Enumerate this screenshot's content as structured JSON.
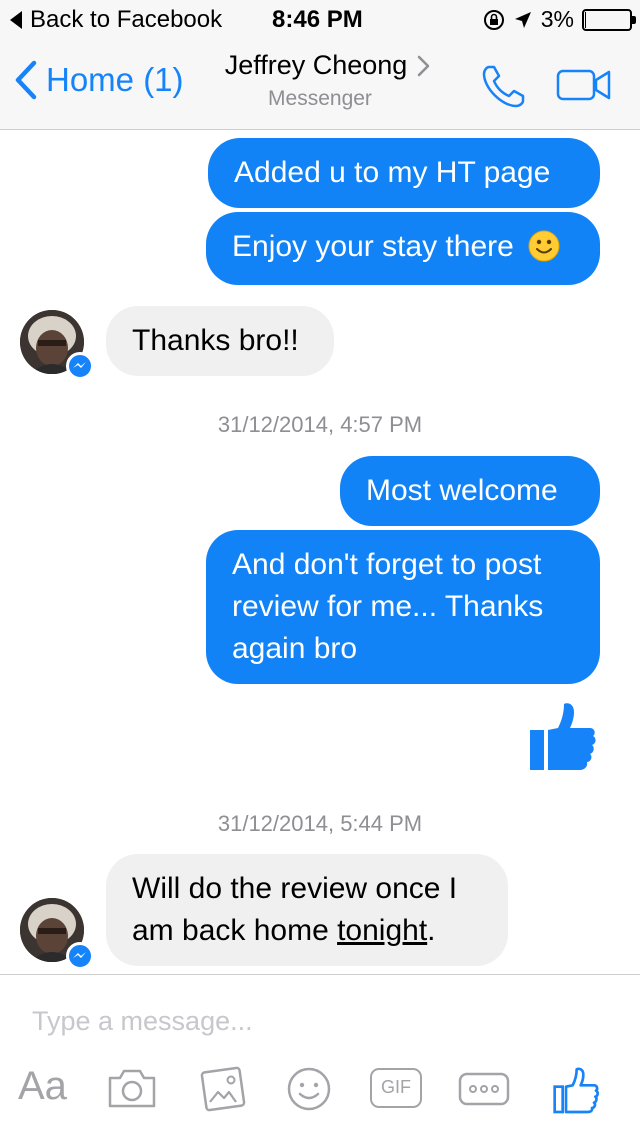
{
  "status_bar": {
    "back_app": "Back to Facebook",
    "time": "8:46 PM",
    "battery_percent": "3%",
    "battery_level": 0.03
  },
  "nav": {
    "back_label": "Home (1)",
    "contact_name": "Jeffrey Cheong",
    "subtitle": "Messenger"
  },
  "messages": [
    {
      "direction": "outgoing",
      "text": "Added u to my HT page"
    },
    {
      "direction": "outgoing",
      "text": "Enjoy your stay there",
      "emoji": "slightly-smiling-face"
    },
    {
      "direction": "incoming",
      "text": "Thanks bro!!"
    },
    {
      "direction": "outgoing",
      "text": "Most welcome"
    },
    {
      "direction": "outgoing",
      "lines": [
        "And don't forget to post",
        "review for me... Thanks",
        "again bro"
      ]
    },
    {
      "direction": "outgoing",
      "sticker": "thumbs-up"
    },
    {
      "direction": "incoming",
      "lines": [
        "Will do the review once I",
        "am back home "
      ],
      "underlined": "tonight",
      "suffix": "."
    }
  ],
  "timestamps": [
    "31/12/2014, 4:57 PM",
    "31/12/2014, 5:44 PM"
  ],
  "composer": {
    "placeholder": "Type a message...",
    "text_tool_label": "Aa",
    "gif_label": "GIF"
  },
  "colors": {
    "accent": "#1683f8",
    "outgoing_bubble": "#1283f7",
    "incoming_bubble": "#f0f0f0",
    "muted_text": "#8e8e93"
  }
}
